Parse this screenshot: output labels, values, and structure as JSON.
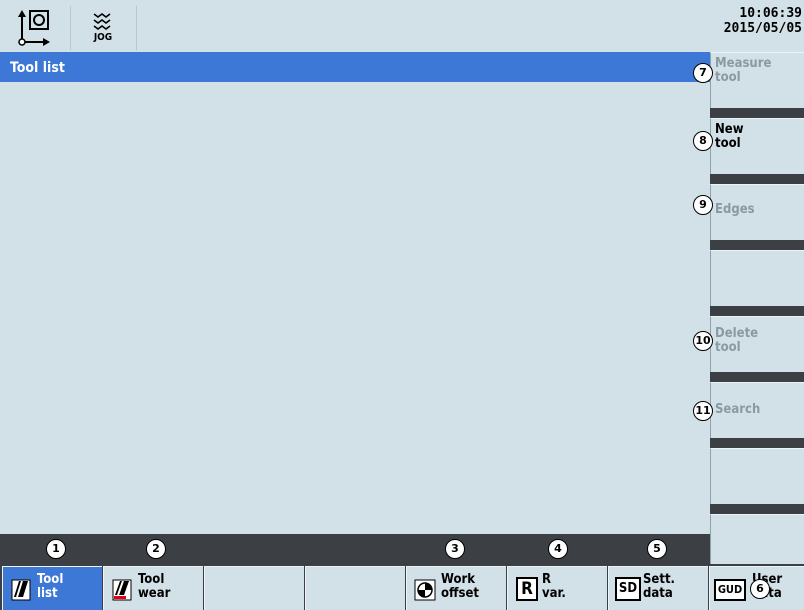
{
  "status_bar": {
    "mode_icon": "machine-axes-icon",
    "jog_icon": "jog-wave-icon",
    "jog_label": "JOG",
    "time": "10:06:39",
    "date": "2015/05/05"
  },
  "window": {
    "title": "Tool list"
  },
  "vertical_softkeys": [
    {
      "num": "7",
      "label_line1": "Measure",
      "label_line2": "tool",
      "enabled": false
    },
    {
      "num": "8",
      "label_line1": "New",
      "label_line2": "tool",
      "enabled": true
    },
    {
      "num": "9",
      "label_line1": "Edges",
      "label_line2": "",
      "enabled": false
    },
    {
      "num": "",
      "label_line1": "",
      "label_line2": "",
      "enabled": false
    },
    {
      "num": "10",
      "label_line1": "Delete",
      "label_line2": "tool",
      "enabled": false
    },
    {
      "num": "11",
      "label_line1": "Search",
      "label_line2": "",
      "enabled": false
    },
    {
      "num": "",
      "label_line1": "",
      "label_line2": "",
      "enabled": false
    },
    {
      "num": "",
      "label_line1": "",
      "label_line2": "",
      "enabled": false
    }
  ],
  "number_strip": [
    "1",
    "2",
    "3",
    "4",
    "5"
  ],
  "horizontal_softkeys": [
    {
      "icon": "tool-icon",
      "label_line1": "Tool",
      "label_line2": "list",
      "active": true
    },
    {
      "icon": "tool-wear-icon",
      "label_line1": "Tool",
      "label_line2": "wear",
      "active": false
    },
    {
      "icon": "",
      "label_line1": "",
      "label_line2": "",
      "active": false
    },
    {
      "icon": "",
      "label_line1": "",
      "label_line2": "",
      "active": false
    },
    {
      "icon": "work-offset-icon",
      "label_line1": "Work",
      "label_line2": "offset",
      "active": false
    },
    {
      "icon": "r-variable-icon",
      "icon_text": "R",
      "label_line1": "R",
      "label_line2": "var.",
      "active": false
    },
    {
      "icon": "setting-data-icon",
      "icon_text": "SD",
      "label_line1": "Sett.",
      "label_line2": "data",
      "active": false
    },
    {
      "icon": "user-data-icon",
      "icon_text": "GUD",
      "badge": "6",
      "label_line1": "User",
      "label_line2": "data",
      "active": false
    }
  ]
}
